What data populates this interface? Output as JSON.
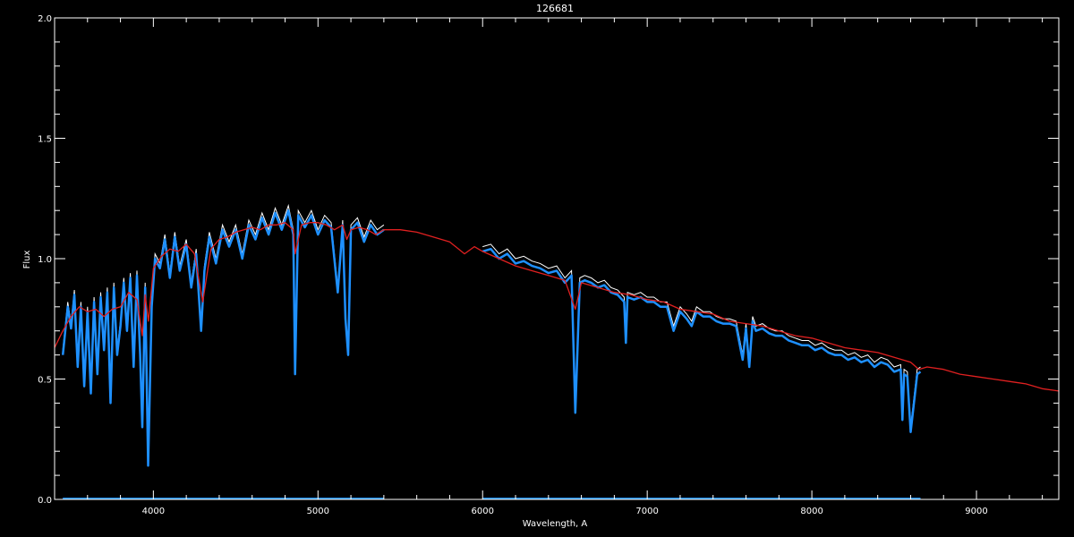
{
  "chart_data": {
    "type": "line",
    "title": "126681",
    "xlabel": "Wavelength, A",
    "ylabel": "Flux",
    "xlim": [
      3400,
      9500
    ],
    "ylim": [
      0.0,
      2.0
    ],
    "x_ticks": [
      4000,
      5000,
      6000,
      7000,
      8000,
      9000
    ],
    "x_tick_labels": [
      "4000",
      "5000",
      "6000",
      "7000",
      "8000",
      "9000"
    ],
    "y_ticks": [
      0.0,
      0.5,
      1.0,
      1.5,
      2.0
    ],
    "y_tick_labels": [
      "0.0",
      "0.5",
      "1.0",
      "1.5",
      "2.0"
    ],
    "grid": false,
    "colors": {
      "background": "#000000",
      "axes": "#ffffff",
      "observed": "#1e90ff",
      "observed_upper": "#ffffff",
      "model": "#e02020"
    },
    "series": [
      {
        "key": "model",
        "color": "#e02020",
        "x": [
          3400,
          3450,
          3500,
          3550,
          3600,
          3650,
          3700,
          3750,
          3800,
          3850,
          3900,
          3933,
          3950,
          3970,
          4000,
          4050,
          4100,
          4150,
          4200,
          4250,
          4300,
          4350,
          4400,
          4450,
          4500,
          4550,
          4600,
          4650,
          4700,
          4750,
          4800,
          4850,
          4861,
          4900,
          4950,
          5000,
          5050,
          5100,
          5150,
          5175,
          5200,
          5250,
          5300,
          5350,
          5400,
          5500,
          5600,
          5700,
          5800,
          5890,
          5950,
          6000,
          6100,
          6200,
          6300,
          6400,
          6500,
          6563,
          6600,
          6700,
          6800,
          6900,
          7000,
          7100,
          7200,
          7300,
          7400,
          7500,
          7600,
          7700,
          7800,
          7900,
          8000,
          8100,
          8200,
          8300,
          8400,
          8500,
          8600,
          8650,
          8700,
          8800,
          8900,
          9000,
          9100,
          9200,
          9300,
          9400,
          9500
        ],
        "y": [
          0.63,
          0.7,
          0.76,
          0.8,
          0.78,
          0.79,
          0.76,
          0.79,
          0.8,
          0.86,
          0.83,
          0.68,
          0.85,
          0.74,
          0.96,
          1.01,
          1.04,
          1.03,
          1.06,
          1.02,
          0.82,
          1.04,
          1.08,
          1.09,
          1.11,
          1.12,
          1.13,
          1.12,
          1.14,
          1.14,
          1.15,
          1.12,
          1.02,
          1.14,
          1.15,
          1.15,
          1.14,
          1.12,
          1.14,
          1.08,
          1.12,
          1.13,
          1.12,
          1.1,
          1.12,
          1.12,
          1.11,
          1.09,
          1.07,
          1.02,
          1.05,
          1.03,
          1.0,
          0.97,
          0.95,
          0.93,
          0.91,
          0.79,
          0.9,
          0.88,
          0.86,
          0.85,
          0.83,
          0.82,
          0.79,
          0.78,
          0.77,
          0.74,
          0.73,
          0.72,
          0.7,
          0.68,
          0.67,
          0.65,
          0.63,
          0.62,
          0.61,
          0.59,
          0.57,
          0.54,
          0.55,
          0.54,
          0.52,
          0.51,
          0.5,
          0.49,
          0.48,
          0.46,
          0.45
        ]
      },
      {
        "key": "observed",
        "color": "#1e90ff",
        "segments": [
          {
            "x": [
              3450,
              3480,
              3500,
              3520,
              3540,
              3560,
              3580,
              3600,
              3620,
              3640,
              3660,
              3680,
              3700,
              3720,
              3740,
              3760,
              3780,
              3800,
              3820,
              3840,
              3860,
              3880,
              3900,
              3920,
              3933,
              3950,
              3968,
              3990,
              4010,
              4040,
              4070,
              4100,
              4130,
              4160,
              4200,
              4230,
              4260,
              4290,
              4310,
              4340,
              4380,
              4420,
              4460,
              4500,
              4540,
              4580,
              4620,
              4660,
              4700,
              4740,
              4780,
              4820,
              4850,
              4861,
              4880,
              4920,
              4960,
              5000,
              5040,
              5080,
              5120,
              5150,
              5167,
              5183,
              5200,
              5240,
              5280,
              5320,
              5360,
              5400
            ],
            "y": [
              0.6,
              0.8,
              0.71,
              0.85,
              0.55,
              0.8,
              0.47,
              0.78,
              0.44,
              0.82,
              0.52,
              0.84,
              0.62,
              0.86,
              0.4,
              0.88,
              0.6,
              0.72,
              0.9,
              0.7,
              0.92,
              0.55,
              0.93,
              0.6,
              0.3,
              0.88,
              0.14,
              0.8,
              1.0,
              0.96,
              1.08,
              0.92,
              1.09,
              0.95,
              1.06,
              0.88,
              1.02,
              0.7,
              0.95,
              1.09,
              0.98,
              1.12,
              1.05,
              1.12,
              1.0,
              1.14,
              1.08,
              1.17,
              1.1,
              1.19,
              1.12,
              1.2,
              1.1,
              0.52,
              1.18,
              1.13,
              1.18,
              1.1,
              1.16,
              1.13,
              0.86,
              1.14,
              0.75,
              0.6,
              1.12,
              1.15,
              1.07,
              1.14,
              1.1,
              1.12
            ]
          },
          {
            "x": [
              6000,
              6050,
              6100,
              6150,
              6200,
              6250,
              6300,
              6350,
              6400,
              6450,
              6500,
              6540,
              6563,
              6590,
              6620,
              6660,
              6700,
              6740,
              6780,
              6820,
              6860,
              6870,
              6880,
              6920,
              6960,
              7000,
              7040,
              7080,
              7120,
              7160,
              7200,
              7240,
              7270,
              7300,
              7340,
              7380,
              7420,
              7460,
              7500,
              7540,
              7580,
              7600,
              7620,
              7640,
              7660,
              7700,
              7740,
              7780,
              7820,
              7860,
              7900,
              7940,
              7980,
              8020,
              8060,
              8100,
              8140,
              8180,
              8220,
              8260,
              8300,
              8340,
              8380,
              8420,
              8460,
              8500,
              8540,
              8550,
              8560,
              8580,
              8600,
              8640,
              8660
            ],
            "y": [
              1.03,
              1.04,
              1.0,
              1.02,
              0.98,
              0.99,
              0.97,
              0.96,
              0.94,
              0.95,
              0.9,
              0.93,
              0.36,
              0.9,
              0.91,
              0.9,
              0.88,
              0.89,
              0.86,
              0.85,
              0.82,
              0.65,
              0.84,
              0.83,
              0.84,
              0.82,
              0.82,
              0.8,
              0.8,
              0.7,
              0.78,
              0.75,
              0.72,
              0.78,
              0.76,
              0.76,
              0.74,
              0.73,
              0.73,
              0.72,
              0.58,
              0.71,
              0.55,
              0.74,
              0.7,
              0.71,
              0.69,
              0.68,
              0.68,
              0.66,
              0.65,
              0.64,
              0.64,
              0.62,
              0.63,
              0.61,
              0.6,
              0.6,
              0.58,
              0.59,
              0.57,
              0.58,
              0.55,
              0.57,
              0.56,
              0.53,
              0.54,
              0.33,
              0.52,
              0.51,
              0.28,
              0.52,
              0.53
            ]
          }
        ]
      },
      {
        "key": "error",
        "color": "#1e90ff",
        "segments": [
          {
            "x": [
              3450,
              5400
            ],
            "y": [
              0.005,
              0.005
            ]
          },
          {
            "x": [
              6000,
              8660
            ],
            "y": [
              0.005,
              0.005
            ]
          }
        ]
      }
    ]
  }
}
